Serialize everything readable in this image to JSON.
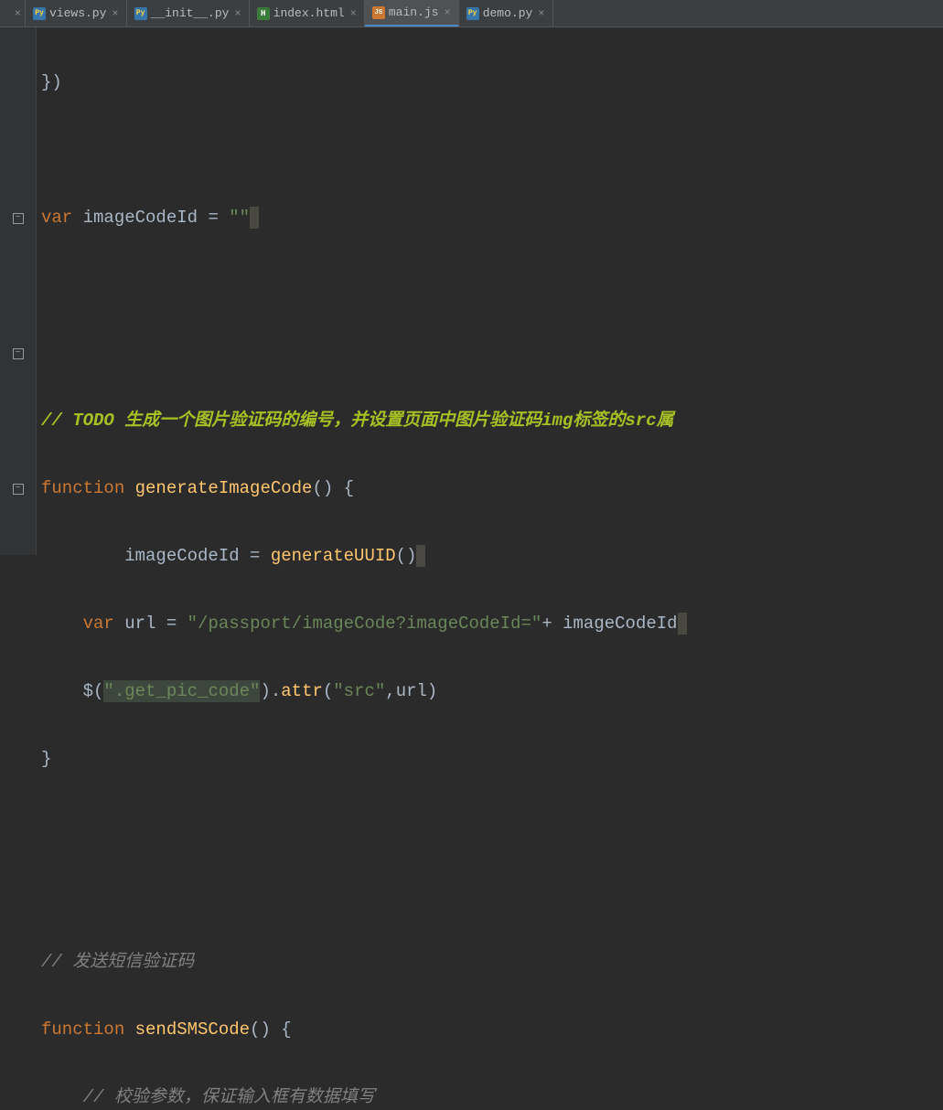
{
  "tabs": [
    {
      "label": "views.py",
      "icon": "py",
      "active": false
    },
    {
      "label": "__init__.py",
      "icon": "py",
      "active": false
    },
    {
      "label": "index.html",
      "icon": "html",
      "active": false
    },
    {
      "label": "main.js",
      "icon": "js",
      "active": true
    },
    {
      "label": "demo.py",
      "icon": "py",
      "active": false
    }
  ],
  "code": {
    "line1": "})",
    "line2": "",
    "line3_kw": "var",
    "line3_var": " imageCodeId = ",
    "line3_str": "\"\"",
    "line4": "",
    "line5": "",
    "line6_prefix": "// ",
    "line6_todo": "TODO 生成一个图片验证码的编号，并设置页面中图片验证码img标签的src属",
    "line7_kw": "function",
    "line7_fn": " generateImageCode",
    "line7_punct": "() {",
    "line8_var": "        imageCodeId = ",
    "line8_fn": "generateUUID",
    "line8_punct": "()",
    "line9_kw": "    var",
    "line9_var": " url = ",
    "line9_str1": "\"/passport/imageCode?imageCodeId=\"",
    "line9_plus": "+ imageCodeId",
    "line10_jq": "    $(",
    "line10_str": "\".get_pic_code\"",
    "line10_attr": ").",
    "line10_fn": "attr",
    "line10_args": "(",
    "line10_str2": "\"src\"",
    "line10_end": ",url)",
    "line11": "}",
    "line12": "",
    "line13": "",
    "line14": "// 发送短信验证码",
    "line15_kw": "function",
    "line15_fn": " sendSMSCode",
    "line15_punct": "() {",
    "line16": "    // 校验参数，保证输入框有数据填写"
  }
}
